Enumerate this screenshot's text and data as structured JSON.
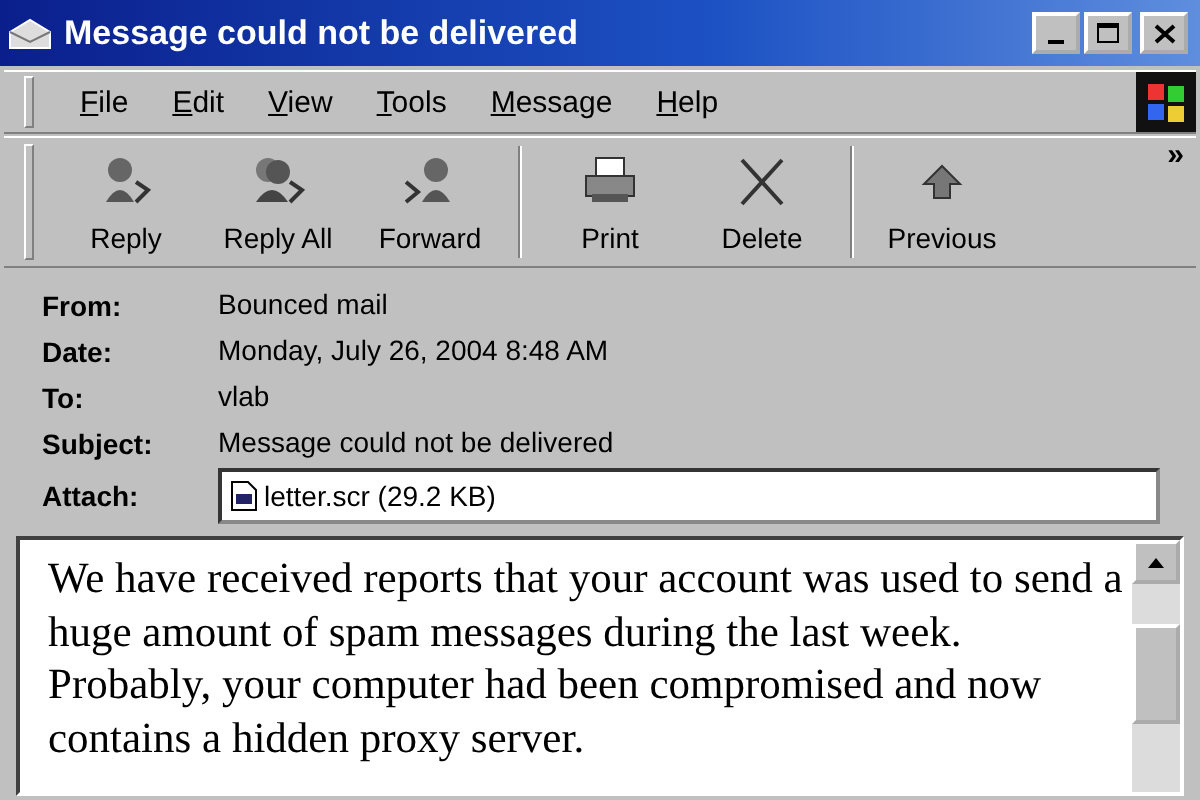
{
  "window": {
    "title": "Message could not be delivered"
  },
  "menu": [
    "File",
    "Edit",
    "View",
    "Tools",
    "Message",
    "Help"
  ],
  "toolbar": {
    "groups": [
      [
        {
          "label": "Reply",
          "kind": "reply"
        },
        {
          "label": "Reply All",
          "kind": "reply_all"
        },
        {
          "label": "Forward",
          "kind": "forward"
        }
      ],
      [
        {
          "label": "Print",
          "kind": "print"
        },
        {
          "label": "Delete",
          "kind": "delete"
        }
      ],
      [
        {
          "label": "Previous",
          "kind": "previous"
        }
      ]
    ],
    "overflow": "»"
  },
  "header": [
    {
      "label": "From:",
      "value": "Bounced mail"
    },
    {
      "label": "Date:",
      "value": "Monday, July 26, 2004 8:48 AM"
    },
    {
      "label": "To:",
      "value": "vlab"
    },
    {
      "label": "Subject:",
      "value": "Message could not be delivered"
    },
    {
      "label": "Attach:",
      "value": "letter.scr (29.2 KB)",
      "kind": "attachment"
    }
  ],
  "body": [
    "We have received reports that your account was used to send a huge amount of spam messages during the last week.",
    "Probably, your computer had been compromised and now contains a hidden proxy server."
  ]
}
